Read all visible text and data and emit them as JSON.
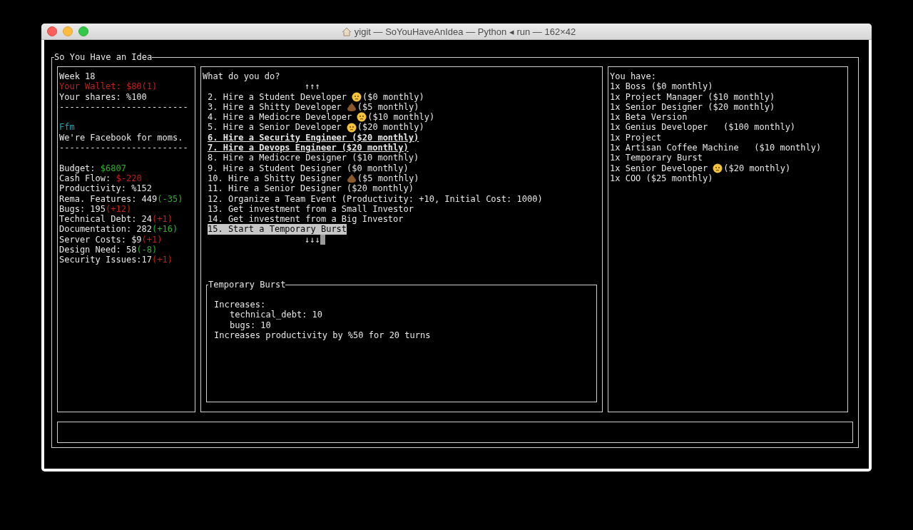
{
  "window": {
    "title": "yigit — SoYouHaveAnIdea — Python ◂ run — 162×42"
  },
  "app": {
    "title": "So You Have an Idea"
  },
  "status_panel": {
    "lines": [
      {
        "kind": "text",
        "text": "Week 18"
      },
      {
        "kind": "text",
        "text": "Your Wallet: $80(1)",
        "color": "#c4201c"
      },
      {
        "kind": "text",
        "text": "Your shares: %100"
      },
      {
        "kind": "text",
        "text": "-------------------------"
      },
      {
        "kind": "spacer"
      },
      {
        "kind": "text",
        "text": "Ffm",
        "color": "#27a3b5"
      },
      {
        "kind": "text",
        "text": "We're Facebook for moms."
      },
      {
        "kind": "text",
        "text": "-------------------------"
      },
      {
        "kind": "spacer"
      },
      {
        "kind": "text",
        "text": "Budget: ",
        "suffix": "$6807",
        "color": "#2fae2f"
      },
      {
        "kind": "text",
        "text": "Cash Flow: ",
        "suffix": "$-220",
        "color": "#c4201c"
      },
      {
        "kind": "text",
        "text": "Productivity: %152"
      },
      {
        "kind": "text",
        "text": "Rema. Features: 449",
        "suffix": "(-35)",
        "color": "#2fae2f"
      },
      {
        "kind": "text",
        "text": "Bugs: 195",
        "suffix": "(+12)",
        "color": "#c4201c"
      },
      {
        "kind": "text",
        "text": "Technical Debt: 24",
        "suffix": "(+1)",
        "color": "#c4201c"
      },
      {
        "kind": "text",
        "text": "Documentation: 282",
        "suffix": "(+16)",
        "color": "#2fae2f"
      },
      {
        "kind": "text",
        "text": "Server Costs: $9",
        "suffix": "(+1)",
        "color": "#c4201c"
      },
      {
        "kind": "text",
        "text": "Design Need: 58",
        "suffix": "(-8)",
        "color": "#2fae2f"
      },
      {
        "kind": "text",
        "text": "Security Issues:17",
        "suffix": "(+1)",
        "color": "#c4201c"
      }
    ]
  },
  "menu": {
    "prompt": "What do you do?",
    "scroll_up": "↑↑↑",
    "scroll_down": "↓↓↓",
    "items": [
      {
        "kind": "face",
        "text": "2. Hire a Student Developer",
        "cost": "($0 monthly)",
        "emphasized": false,
        "selected": false
      },
      {
        "kind": "poop",
        "text": "3. Hire a Shitty Developer",
        "cost": "($5 monthly)",
        "emphasized": false,
        "selected": false
      },
      {
        "kind": "face",
        "text": "4. Hire a Mediocre Developer",
        "cost": "($10 monthly)",
        "emphasized": false,
        "selected": false
      },
      {
        "kind": "face",
        "text": "5. Hire a Senior Developer",
        "cost": "($20 monthly)",
        "emphasized": false,
        "selected": false
      },
      {
        "kind": "text",
        "text": "6. Hire a Security Engineer ($20 monthly)",
        "emphasized": true,
        "selected": false
      },
      {
        "kind": "text",
        "text": "7. Hire a Devops Engineer ($20 monthly)",
        "emphasized": true,
        "selected": false
      },
      {
        "kind": "text",
        "text": "8. Hire a Mediocre Designer ($10 monthly)",
        "emphasized": false,
        "selected": false
      },
      {
        "kind": "text",
        "text": "9. Hire a Student Designer ($0 monthly)",
        "emphasized": false,
        "selected": false
      },
      {
        "kind": "poop",
        "text": "10. Hire a Shitty Designer",
        "cost": "($5 monthly)",
        "emphasized": false,
        "selected": false
      },
      {
        "kind": "text",
        "text": "11. Hire a Senior Designer ($20 monthly)",
        "emphasized": false,
        "selected": false
      },
      {
        "kind": "text",
        "text": "12. Organize a Team Event (Productivity: +10, Initial Cost: 1000)",
        "emphasized": false,
        "selected": false
      },
      {
        "kind": "text",
        "text": "13. Get investment from a Small Investor",
        "emphasized": false,
        "selected": false
      },
      {
        "kind": "text",
        "text": "14. Get investment from a Big Investor",
        "emphasized": false,
        "selected": false
      },
      {
        "kind": "text",
        "text": "15. Start a Temporary Burst",
        "emphasized": false,
        "selected": true
      }
    ]
  },
  "detail": {
    "title": "Temporary Burst",
    "lines": [
      {
        "indent": false,
        "text": "Increases:"
      },
      {
        "indent": true,
        "text": "technical_debt: 10"
      },
      {
        "indent": true,
        "text": "bugs: 10"
      },
      {
        "indent": false,
        "text": "Increases productivity by %50 for 20 turns"
      }
    ]
  },
  "inventory": {
    "heading": "You have:",
    "items": [
      {
        "kind": "text",
        "text": "1x Boss ($0 monthly)"
      },
      {
        "kind": "text",
        "text": "1x Project Manager ($10 monthly)"
      },
      {
        "kind": "text",
        "text": "1x Senior Designer ($20 monthly)"
      },
      {
        "kind": "text",
        "text": "1x Beta Version"
      },
      {
        "kind": "text",
        "text": "1x Genius Developer   ($100 monthly)"
      },
      {
        "kind": "text",
        "text": "1x Project"
      },
      {
        "kind": "text",
        "text": "1x Artisan Coffee Machine   ($10 monthly)"
      },
      {
        "kind": "text",
        "text": "1x Temporary Burst"
      },
      {
        "kind": "face",
        "text": "1x Senior Developer",
        "cost": "($20 monthly)"
      },
      {
        "kind": "text",
        "text": "1x COO ($25 monthly)"
      }
    ]
  }
}
